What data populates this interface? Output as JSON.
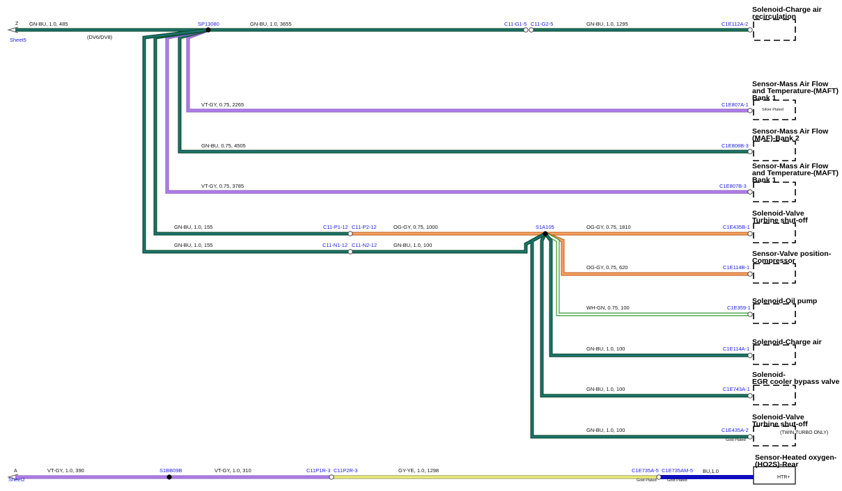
{
  "colors": {
    "gn_outer": "#0c4a3c",
    "gn_inner": "#1f8c3a",
    "bu_inner": "#1c5aa6",
    "vt": "#b07de8",
    "vt_edge": "#7a55b0",
    "og": "#f0904a",
    "og_edge": "#b85e1e",
    "wh_gn": "#2e9a2e",
    "gy_ye": "#eef07a",
    "gy_ye_edge": "#8a8a50",
    "bu": "#0d0dbf",
    "connector_label": "#1a1ae6"
  },
  "sheets": {
    "top_marker": "Z",
    "top_sheet": "Sheet5",
    "bottom_marker": "A",
    "bottom_sheet": "Sheet2"
  },
  "splices": {
    "sp13080": "SP13080",
    "s1a105": "S1A105",
    "s1bb09b": "S1BB09B"
  },
  "wire_labels": {
    "w_sheet5": "GN-BU,  1.0,  485",
    "variant": "(DV6/DV8)",
    "w_sp_c11": "GN-BU,  1.0,  3655",
    "w_c11_c1e112": "GN-BU,  1.0,  1295",
    "w_maft1": "VT-GY,  0.75,  2265",
    "w_maf2": "GN-BU,  0.75,  4505",
    "w_maft1b": "VT-GY,  0.75,  3785",
    "w_p1": "GN-BU,  1.0,  155",
    "w_p2_s1a": "OG-GY,  0.75,  1000",
    "w_s1a_c1e435b": "OG-GY,  0.75,  1810",
    "w_n1": "GN-BU,  1.0,  155",
    "w_n2_s1a": "GN-BU,  1.0,  100",
    "w_c1e114b": "OG-GY,  0.75,  620",
    "w_c1e359": "WH-GN,  0.75,  100",
    "w_c1e114a": "GN-BU,  1.0,  100",
    "w_c1e743a": "GN-BU,  1.0,  100",
    "w_c1e435a": "GN-BU,  1.0,  100",
    "w_sheet2": "VT-GY,  1.0,  390",
    "w_s1bb_c11p1r": "VT-GY,  1.0,  310",
    "w_c11p2r_c1e735": "GY-YE,  1.0,  1298",
    "w_bu": "BU,1.0"
  },
  "connectors": {
    "c11_g1": "C11-G1-5",
    "c11_g2": "C11-G2-5",
    "c1e112a": "C1E112A-2",
    "c1e807a": "C1E807A-1",
    "c1e808b": "C1E808B-3",
    "c1e807b": "C1E807B-3",
    "c11_p1": "C11-P1-12",
    "c11_p2": "C11-P2-12",
    "c1e435b": "C1E435B-1",
    "c11_n1": "C11-N1-12",
    "c11_n2": "C11-N2-12",
    "c1e114b": "C1E114B-1",
    "c1e359": "C1E359-1",
    "c1e114a": "C1E114A-1",
    "c1e743a": "C1E743A-1",
    "c1e435a": "C1E435A-2",
    "c11p1r": "C11P1R-3",
    "c11p2r": "C11P2R-3",
    "c1e735a": "C1E735A-5",
    "c1e735am": "C1E735AM-5"
  },
  "notes": {
    "silver_plated": "Silver Plated",
    "gold_plated": "Gold Plated",
    "twin_turbo": "(TWIN TURBO ONLY)",
    "htr_pin": "HTR+"
  },
  "components": {
    "charge_air_recirc": [
      "Solenoid-Charge air",
      "recirculation"
    ],
    "maft_bank1": [
      "Sensor-Mass Air Flow",
      "and Temperature-(MAFT)",
      "Bank 1"
    ],
    "maf_bank2": [
      "Sensor-Mass Air Flow",
      "(MAF)-Bank 2"
    ],
    "maft_bank1b": [
      "Sensor-Mass Air Flow",
      "and Temperature-(MAFT)",
      "Bank 1"
    ],
    "turbine_shutoff": [
      "Solenoid-Valve",
      "Turbine shut-off"
    ],
    "valve_pos_comp": [
      "Sensor-Valve position-",
      "Compressor"
    ],
    "oil_pump": [
      "Solenoid-Oil pump"
    ],
    "charge_air": [
      "Solenoid-Charge air"
    ],
    "egr_bypass": [
      "Solenoid-",
      "EGR cooler bypass valve"
    ],
    "turbine_shutoff_2": [
      "Solenoid-Valve",
      "Turbine shut-off"
    ],
    "ho2s_rear": [
      "Sensor-Heated oxygen-",
      "(HO2S)-Rear"
    ]
  }
}
